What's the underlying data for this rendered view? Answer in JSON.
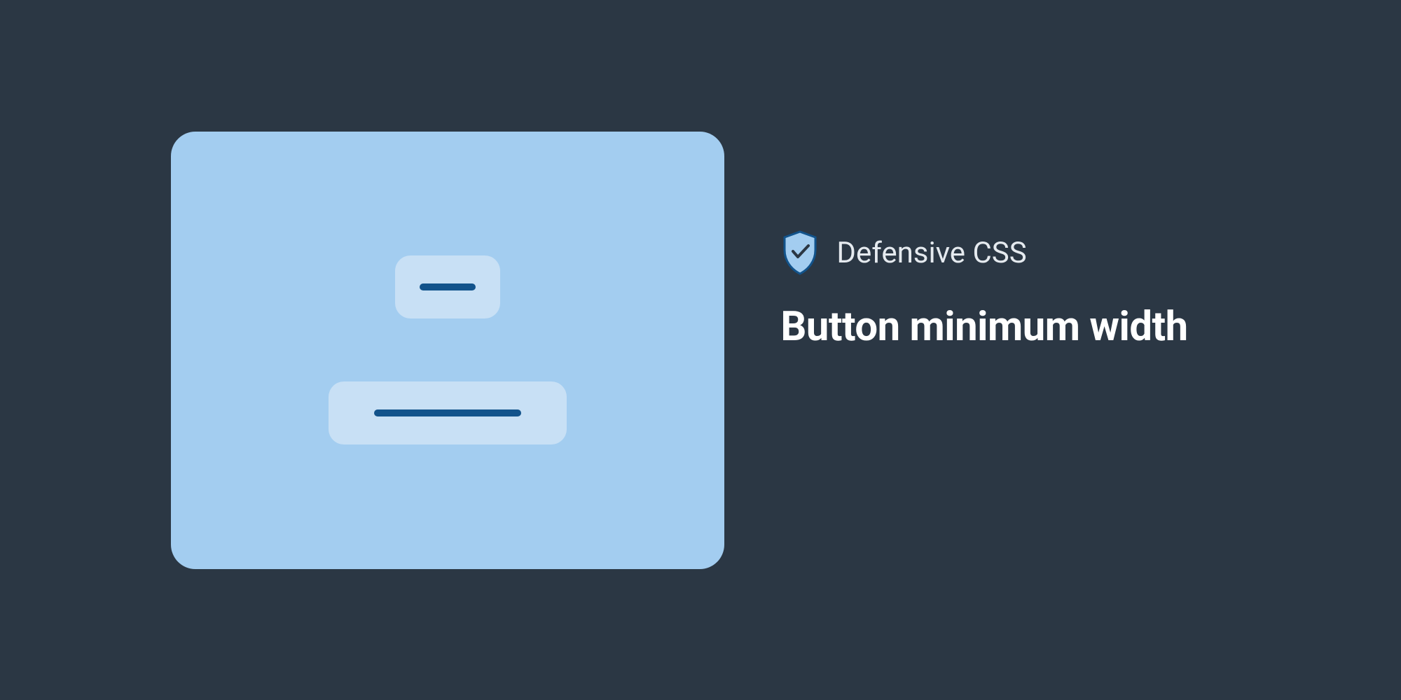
{
  "brand": {
    "label": "Defensive CSS"
  },
  "title": "Button minimum width",
  "colors": {
    "background": "#2b3744",
    "card": "#a3cdf0",
    "button_fill": "#c8e0f5",
    "button_bar": "#12538b",
    "shield_fill": "#a3cdf0",
    "shield_stroke": "#12538b",
    "text_primary": "#ffffff",
    "text_secondary": "#e5eaef"
  }
}
